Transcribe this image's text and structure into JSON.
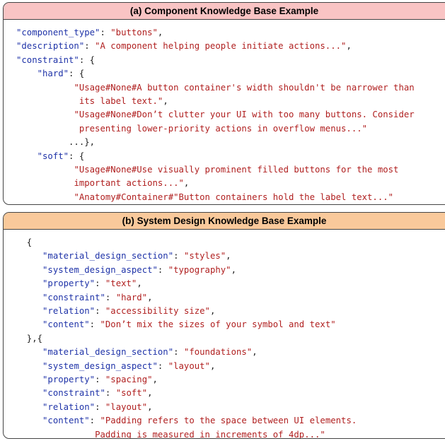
{
  "panel_a": {
    "title": "(a) Component Knowledge Base Example",
    "lines": [
      [
        {
          "t": "p",
          "v": ""
        },
        {
          "t": "k",
          "v": "\"component_type\""
        },
        {
          "t": "p",
          "v": ": "
        },
        {
          "t": "s",
          "v": "\"buttons\""
        },
        {
          "t": "p",
          "v": ","
        }
      ],
      [
        {
          "t": "p",
          "v": ""
        },
        {
          "t": "k",
          "v": "\"description\""
        },
        {
          "t": "p",
          "v": ": "
        },
        {
          "t": "s",
          "v": "\"A component helping people initiate actions...\""
        },
        {
          "t": "p",
          "v": ","
        }
      ],
      [
        {
          "t": "p",
          "v": ""
        },
        {
          "t": "k",
          "v": "\"constraint\""
        },
        {
          "t": "p",
          "v": ": {"
        }
      ],
      [
        {
          "t": "p",
          "v": "    "
        },
        {
          "t": "k",
          "v": "\"hard\""
        },
        {
          "t": "p",
          "v": ": {"
        }
      ],
      [
        {
          "t": "p",
          "v": "           "
        },
        {
          "t": "s",
          "v": "\"Usage#None#A button container's width shouldn't be narrower than"
        }
      ],
      [
        {
          "t": "p",
          "v": "            "
        },
        {
          "t": "s",
          "v": "its label text.\""
        },
        {
          "t": "p",
          "v": ","
        }
      ],
      [
        {
          "t": "p",
          "v": "           "
        },
        {
          "t": "s",
          "v": "\"Usage#None#Don’t clutter your UI with too many buttons. Consider"
        }
      ],
      [
        {
          "t": "p",
          "v": "            "
        },
        {
          "t": "s",
          "v": "presenting lower-priority actions in overflow menus...\""
        }
      ],
      [
        {
          "t": "p",
          "v": "          ...},"
        }
      ],
      [
        {
          "t": "p",
          "v": "    "
        },
        {
          "t": "k",
          "v": "\"soft\""
        },
        {
          "t": "p",
          "v": ": {"
        }
      ],
      [
        {
          "t": "p",
          "v": "           "
        },
        {
          "t": "s",
          "v": "\"Usage#None#Use visually prominent filled buttons for the most"
        }
      ],
      [
        {
          "t": "p",
          "v": "           "
        },
        {
          "t": "s",
          "v": "important actions...\""
        },
        {
          "t": "p",
          "v": ","
        }
      ],
      [
        {
          "t": "p",
          "v": "           "
        },
        {
          "t": "s",
          "v": "\"Anatomy#Container#\"Button containers hold the label text...\""
        }
      ],
      [
        {
          "t": "p",
          "v": "          ...},"
        }
      ]
    ]
  },
  "panel_b": {
    "title": "(b) System Design Knowledge Base Example",
    "lines": [
      [
        {
          "t": "p",
          "v": "  {"
        }
      ],
      [
        {
          "t": "p",
          "v": "     "
        },
        {
          "t": "k",
          "v": "\"material_design_section\""
        },
        {
          "t": "p",
          "v": ": "
        },
        {
          "t": "s",
          "v": "\"styles\""
        },
        {
          "t": "p",
          "v": ","
        }
      ],
      [
        {
          "t": "p",
          "v": "     "
        },
        {
          "t": "k",
          "v": "\"system_design_aspect\""
        },
        {
          "t": "p",
          "v": ": "
        },
        {
          "t": "s",
          "v": "\"typography\""
        },
        {
          "t": "p",
          "v": ","
        }
      ],
      [
        {
          "t": "p",
          "v": "     "
        },
        {
          "t": "k",
          "v": "\"property\""
        },
        {
          "t": "p",
          "v": ": "
        },
        {
          "t": "s",
          "v": "\"text\""
        },
        {
          "t": "p",
          "v": ","
        }
      ],
      [
        {
          "t": "p",
          "v": "     "
        },
        {
          "t": "k",
          "v": "\"constraint\""
        },
        {
          "t": "p",
          "v": ": "
        },
        {
          "t": "s",
          "v": "\"hard\""
        },
        {
          "t": "p",
          "v": ","
        }
      ],
      [
        {
          "t": "p",
          "v": "     "
        },
        {
          "t": "k",
          "v": "\"relation\""
        },
        {
          "t": "p",
          "v": ": "
        },
        {
          "t": "s",
          "v": "\"accessibility size\""
        },
        {
          "t": "p",
          "v": ","
        }
      ],
      [
        {
          "t": "p",
          "v": "     "
        },
        {
          "t": "k",
          "v": "\"content\""
        },
        {
          "t": "p",
          "v": ": "
        },
        {
          "t": "s",
          "v": "\"Don’t mix the sizes of your symbol and text\""
        }
      ],
      [
        {
          "t": "p",
          "v": "  },{"
        }
      ],
      [
        {
          "t": "p",
          "v": "     "
        },
        {
          "t": "k",
          "v": "\"material_design_section\""
        },
        {
          "t": "p",
          "v": ": "
        },
        {
          "t": "s",
          "v": "\"foundations\""
        },
        {
          "t": "p",
          "v": ","
        }
      ],
      [
        {
          "t": "p",
          "v": "     "
        },
        {
          "t": "k",
          "v": "\"system_design_aspect\""
        },
        {
          "t": "p",
          "v": ": "
        },
        {
          "t": "s",
          "v": "\"layout\""
        },
        {
          "t": "p",
          "v": ","
        }
      ],
      [
        {
          "t": "p",
          "v": "     "
        },
        {
          "t": "k",
          "v": "\"property\""
        },
        {
          "t": "p",
          "v": ": "
        },
        {
          "t": "s",
          "v": "\"spacing\""
        },
        {
          "t": "p",
          "v": ","
        }
      ],
      [
        {
          "t": "p",
          "v": "     "
        },
        {
          "t": "k",
          "v": "\"constraint\""
        },
        {
          "t": "p",
          "v": ": "
        },
        {
          "t": "s",
          "v": "\"soft\""
        },
        {
          "t": "p",
          "v": ","
        }
      ],
      [
        {
          "t": "p",
          "v": "     "
        },
        {
          "t": "k",
          "v": "\"relation\""
        },
        {
          "t": "p",
          "v": ": "
        },
        {
          "t": "s",
          "v": "\"layout\""
        },
        {
          "t": "p",
          "v": ","
        }
      ],
      [
        {
          "t": "p",
          "v": "     "
        },
        {
          "t": "k",
          "v": "\"content\""
        },
        {
          "t": "p",
          "v": ": "
        },
        {
          "t": "s",
          "v": "\"Padding refers to the space between UI elements."
        }
      ],
      [
        {
          "t": "p",
          "v": "               "
        },
        {
          "t": "s",
          "v": "Padding is measured in increments of 4dp...\""
        }
      ],
      [
        {
          "t": "p",
          "v": "  }"
        }
      ]
    ]
  },
  "colors": {
    "header_a_bg": "#f9c4c4",
    "header_b_bg": "#f9c99b",
    "key": "#1f33a8",
    "string": "#b01f1f",
    "border": "#444444"
  }
}
